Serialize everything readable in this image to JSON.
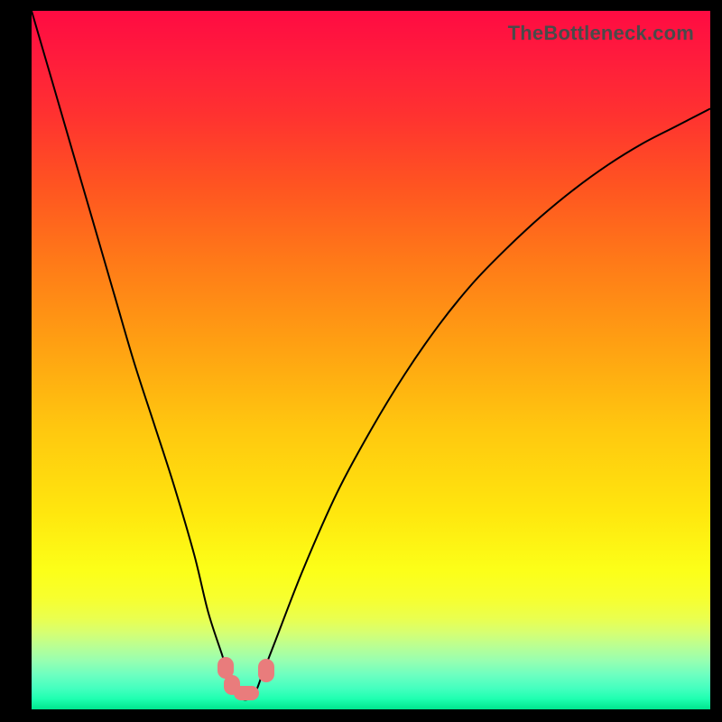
{
  "watermark": "TheBottleneck.com",
  "colors": {
    "curve": "#000000",
    "marker": "#e97c7c",
    "curve_width": 2
  },
  "chart_data": {
    "type": "line",
    "title": "",
    "xlabel": "",
    "ylabel": "",
    "xlim": [
      0,
      100
    ],
    "ylim": [
      0,
      100
    ],
    "grid": false,
    "series": [
      {
        "name": "bottleneck-curve",
        "x": [
          0,
          3,
          6,
          9,
          12,
          15,
          18,
          21,
          24,
          26,
          28,
          29,
          30,
          31,
          32,
          33,
          34,
          36,
          40,
          45,
          50,
          55,
          60,
          65,
          70,
          75,
          80,
          85,
          90,
          95,
          100
        ],
        "y": [
          100,
          90,
          80,
          70,
          60,
          50,
          41,
          32,
          22,
          14,
          8,
          5,
          2.5,
          1.5,
          1.5,
          2.5,
          5,
          10,
          20,
          31,
          40,
          48,
          55,
          61,
          66,
          70.5,
          74.5,
          78,
          81,
          83.5,
          86
        ]
      }
    ],
    "minimum_region_x": [
      28.5,
      33.5
    ],
    "minimum_value_y": 1.5
  }
}
